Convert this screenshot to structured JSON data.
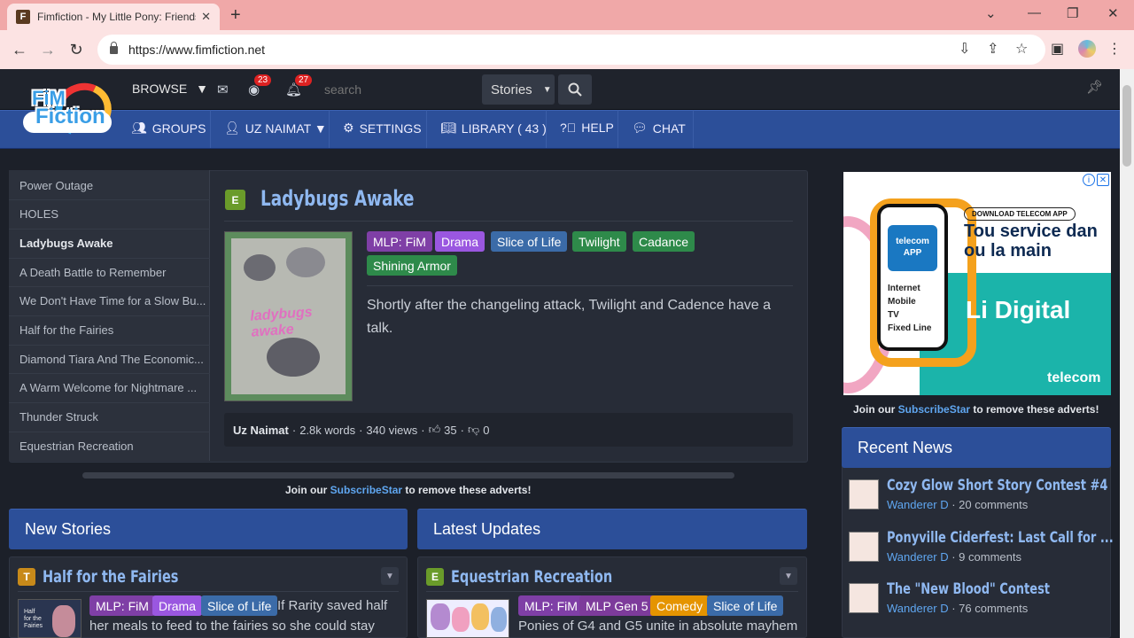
{
  "browser": {
    "tab_title": "Fimfiction - My Little Pony: Friendship is Magic Fan Fiction",
    "favicon_letter": "F",
    "url": "https://www.fimfiction.net"
  },
  "site": {
    "logo_line1": "FiM",
    "logo_line2": "Fiction",
    "browse": "BROWSE",
    "notif_count": "23",
    "alert_count": "27",
    "search_placeholder": "search",
    "stories_select": "Stories",
    "nav": [
      {
        "label": "GROUPS",
        "icon": "users-icon"
      },
      {
        "label": "UZ NAIMAT ▼",
        "icon": "user-icon"
      },
      {
        "label": "SETTINGS",
        "icon": "gear-icon"
      },
      {
        "label": "LIBRARY ( 43 )",
        "icon": "book-icon"
      },
      {
        "label": "HELP",
        "icon": "question-icon"
      },
      {
        "label": "CHAT",
        "icon": "chat-icon"
      }
    ]
  },
  "featured": {
    "list": [
      "Power Outage",
      "HOLES",
      "Ladybugs Awake",
      "A Death Battle to Remember",
      "We Don't Have Time for a Slow Bu...",
      "Half for the Fairies",
      "Diamond Tiara And The Economic...",
      "A Warm Welcome for Nightmare ...",
      "Thunder Struck",
      "Equestrian Recreation"
    ],
    "rating": "E",
    "title": "Ladybugs Awake",
    "cover_text": "ladybugs awake",
    "tags": [
      "MLP: FiM",
      "Drama",
      "Slice of Life",
      "Twilight",
      "Cadance",
      "Shining Armor"
    ],
    "description": "Shortly after the changeling attack, Twilight and Cadence have a talk.",
    "author": "Uz Naimat",
    "words": "2.8k words",
    "views": "340 views",
    "likes": "35",
    "dislikes": "0"
  },
  "support_text": {
    "pre": "Join our ",
    "link": "SubscribeStar",
    "post": " to remove these adverts!"
  },
  "new_stories": {
    "heading": "New Stories",
    "story": {
      "rating": "T",
      "title": "Half for the Fairies",
      "tags": [
        "MLP: FiM",
        "Drama",
        "Slice of Life"
      ],
      "desc_line1": "If Rarity saved half",
      "desc_line2": "her meals to feed to the fairies so she could stay"
    }
  },
  "latest_updates": {
    "heading": "Latest Updates",
    "story": {
      "rating": "E",
      "title": "Equestrian Recreation",
      "tags": [
        "MLP: FiM",
        "MLP Gen 5",
        "Comedy",
        "Slice of Life"
      ],
      "desc_line1": "Ponies of G4 and G5 unite in absolute mayhem"
    }
  },
  "ad": {
    "pill": "DOWNLOAD TELECOM APP",
    "headline": "Tou service dan ou la main",
    "app_label": "telecom APP",
    "menu": [
      "Internet",
      "Mobile",
      "TV",
      "Fixed Line"
    ],
    "big": "Li Digital",
    "brand": "telecom"
  },
  "recent_news": {
    "heading": "Recent News",
    "items": [
      {
        "title": "Cozy Glow Short Story Contest #4",
        "author": "Wanderer D",
        "comments": "· 20 comments"
      },
      {
        "title": "Ponyville Ciderfest: Last Call for ...",
        "author": "Wanderer D",
        "comments": "· 9 comments"
      },
      {
        "title": "The \"New Blood\" Contest",
        "author": "Wanderer D",
        "comments": "· 76 comments"
      }
    ]
  },
  "colors": {
    "nav_blue": "#2c4f99",
    "title_blue": "#8fb8f0",
    "link_blue": "#5fa6f0",
    "bg_dark": "#1c2029"
  }
}
